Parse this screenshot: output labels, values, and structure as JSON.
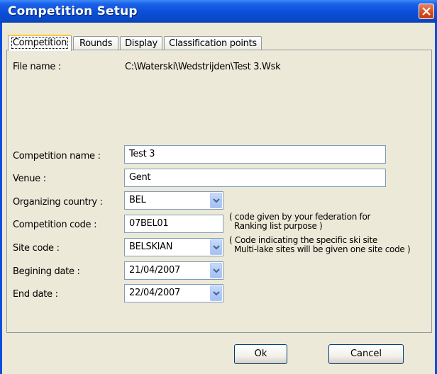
{
  "window": {
    "title": "Competition Setup"
  },
  "tabs": [
    {
      "label": "Competition"
    },
    {
      "label": "Rounds"
    },
    {
      "label": "Display"
    },
    {
      "label": "Classification points"
    }
  ],
  "file": {
    "label": "File name :",
    "value": "C:\\Waterski\\Wedstrijden\\Test 3.Wsk"
  },
  "fields": {
    "competition_name": {
      "label": "Competition name :",
      "value": "Test 3"
    },
    "venue": {
      "label": "Venue :",
      "value": "Gent"
    },
    "organizing_country": {
      "label": "Organizing country :",
      "value": "BEL"
    },
    "competition_code": {
      "label": "Competition code :",
      "value": "07BEL01",
      "note_line1": "( code given by your federation for",
      "note_line2": "Ranking list purpose )"
    },
    "site_code": {
      "label": "Site code :",
      "value": "BELSKIAN",
      "note_line1": "( Code indicating the specific ski site",
      "note_line2": "Multi-lake sites will be given one site code )"
    },
    "beginning_date": {
      "label": "Begining date :",
      "value": "21/04/2007"
    },
    "end_date": {
      "label": "End date :",
      "value": "22/04/2007"
    }
  },
  "buttons": {
    "ok": "Ok",
    "cancel": "Cancel"
  },
  "colors": {
    "title_bar": "#0a4fd8",
    "dialog_bg": "#ece9d8",
    "close_button": "#d54a1f",
    "active_tab_highlight": "#ffc83c"
  }
}
